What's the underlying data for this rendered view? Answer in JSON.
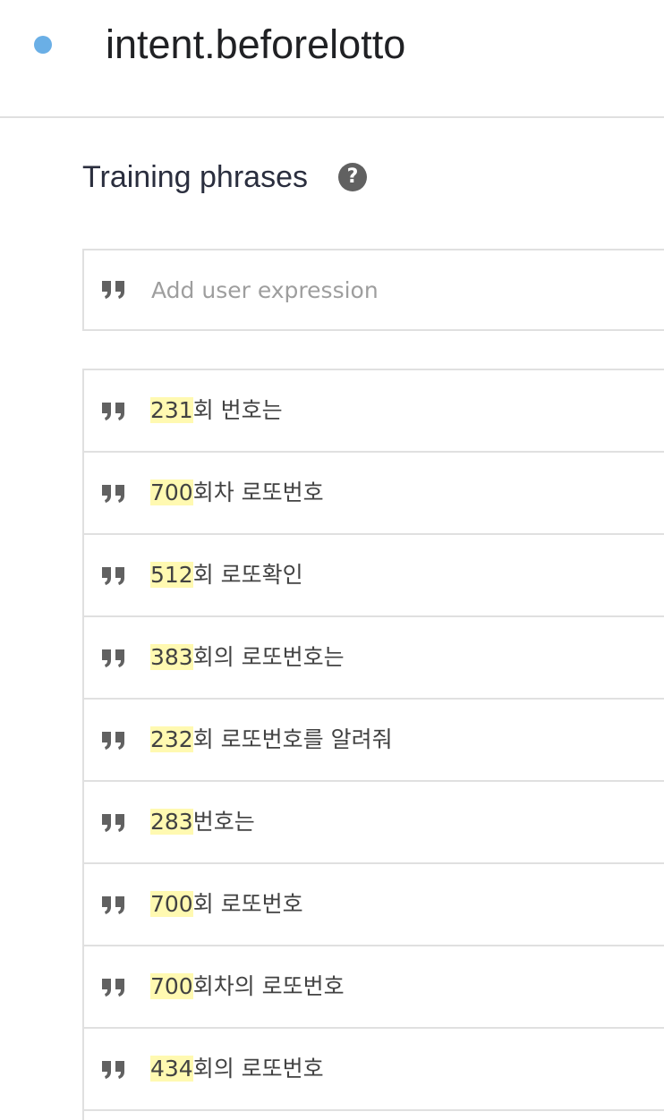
{
  "header": {
    "intent_name": "intent.beforelotto",
    "status_color": "#6aafe6"
  },
  "training_phrases": {
    "title": "Training phrases",
    "help_icon": "help-circle-icon",
    "add_placeholder": "Add user expression",
    "quote_icon": "format-quote-icon",
    "highlight_color": "#fff9b1",
    "phrases": [
      {
        "param": "231",
        "rest": "회 번호는"
      },
      {
        "param": "700",
        "rest": "회차 로또번호"
      },
      {
        "param": "512",
        "rest": "회 로또확인"
      },
      {
        "param": "383",
        "rest": "회의 로또번호는"
      },
      {
        "param": "232",
        "rest": "회 로또번호를 알려줘"
      },
      {
        "param": "283",
        "rest": "번호는"
      },
      {
        "param": "700",
        "rest": "회 로또번호"
      },
      {
        "param": "700",
        "rest": "회차의 로또번호"
      },
      {
        "param": "434",
        "rest": "회의 로또번호"
      }
    ]
  }
}
